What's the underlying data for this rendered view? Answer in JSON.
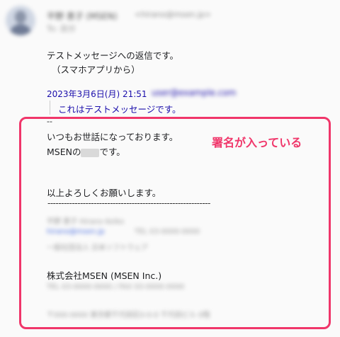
{
  "sender": {
    "name": "平野 恵子 (MSEN)",
    "email": "<hirano@msen.jp>",
    "to": "To: 自分"
  },
  "reply": {
    "line1": "テストメッセージへの返信です。",
    "line2": "（スマホアプリから）"
  },
  "quote": {
    "header": "2023年3月6日(月) 21:51",
    "email": "user@example.com",
    "text": "これはテストメッセージです。"
  },
  "signature": {
    "dashes": "--",
    "greeting": "いつもお世話になっております。",
    "msen_prefix": "MSENの",
    "msen_suffix": "です。",
    "closing": "以上よろしくお願いします。",
    "separator": "------------------------------------------------------------",
    "blur1": "平野 恵子  Hirano Keiko",
    "blur2": "hirano@msen.jp",
    "blur2b": "TEL 03-0000-0000",
    "blur3": "一般社団法人 日本ソフトウェア",
    "company": "株式会社MSEN (MSEN Inc.)",
    "blur4": "TEL 03-0000-0000 / FAX 03-0000-0000",
    "blur5": "〒000-0000 東京都千代田区0-0-0 千代田ビル 0階"
  },
  "callout": "署名が入っている"
}
